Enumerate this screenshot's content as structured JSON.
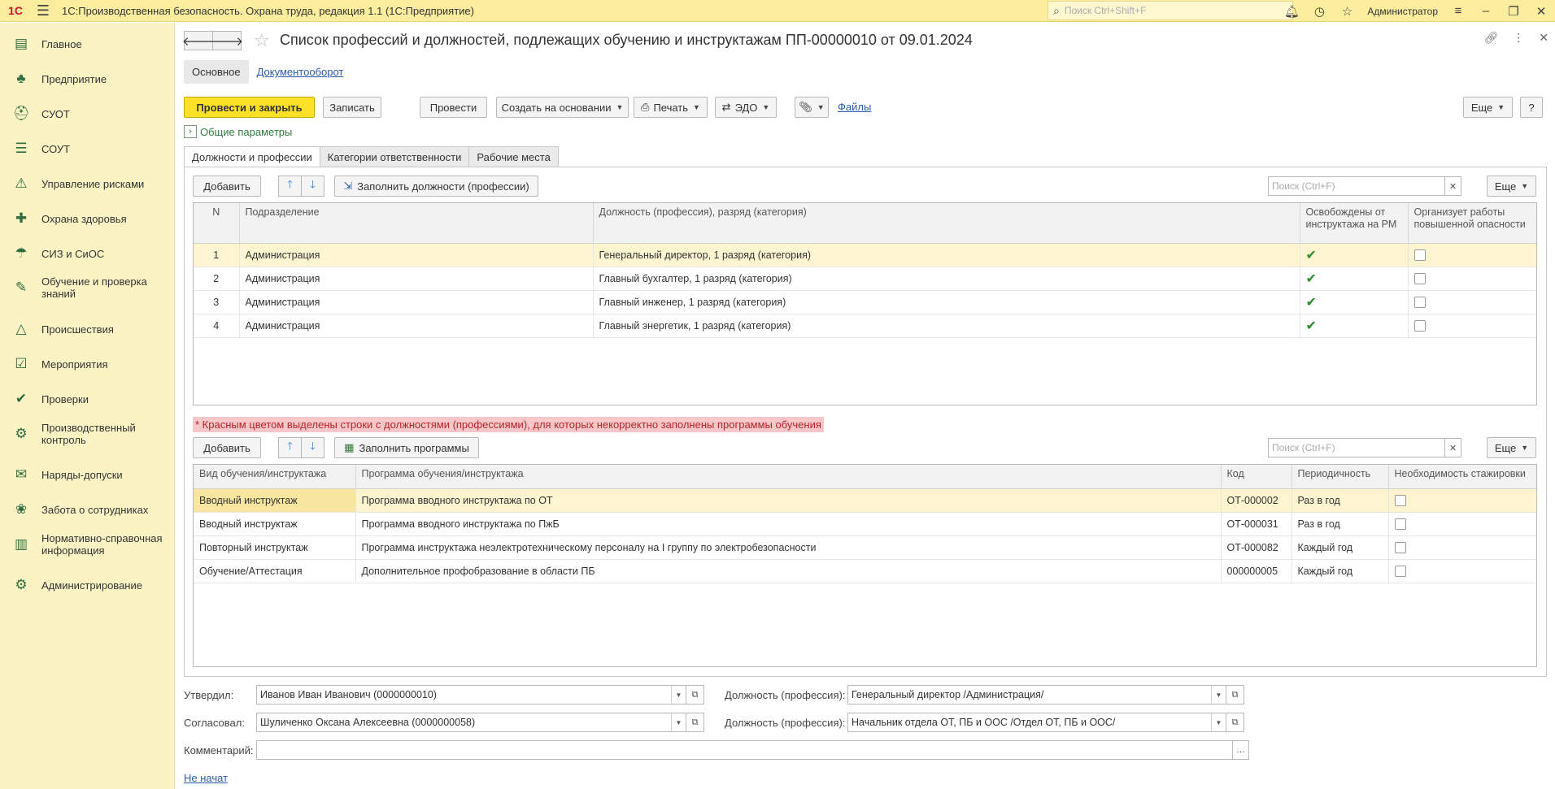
{
  "app": {
    "title": "1С:Производственная безопасность. Охрана труда, редакция 1.1  (1С:Предприятие)",
    "search_placeholder": "Поиск Ctrl+Shift+F",
    "user": "Администратор",
    "logo": "1С"
  },
  "sidebar": {
    "items": [
      {
        "label": "Главное",
        "icon": "dashboard-icon",
        "glyph": "▤"
      },
      {
        "label": "Предприятие",
        "icon": "org-structure-icon",
        "glyph": "♣"
      },
      {
        "label": "СУОТ",
        "icon": "helmet-icon",
        "glyph": "⛑"
      },
      {
        "label": "СОУТ",
        "icon": "checklist-icon",
        "glyph": "☰"
      },
      {
        "label": "Управление рисками",
        "icon": "risk-icon",
        "glyph": "⚠"
      },
      {
        "label": "Охрана здоровья",
        "icon": "health-icon",
        "glyph": "✚"
      },
      {
        "label": "СИЗ и СиОС",
        "icon": "ppe-icon",
        "glyph": "☂"
      },
      {
        "label": "Обучение и проверка знаний",
        "icon": "training-icon",
        "glyph": "✎"
      },
      {
        "label": "Происшествия",
        "icon": "incident-icon",
        "glyph": "△"
      },
      {
        "label": "Мероприятия",
        "icon": "events-icon",
        "glyph": "☑"
      },
      {
        "label": "Проверки",
        "icon": "inspection-icon",
        "glyph": "✔"
      },
      {
        "label": "Производственный контроль",
        "icon": "production-control-icon",
        "glyph": "⚙"
      },
      {
        "label": "Наряды-допуски",
        "icon": "permit-icon",
        "glyph": "✉"
      },
      {
        "label": "Забота о сотрудниках",
        "icon": "care-icon",
        "glyph": "❀"
      },
      {
        "label": "Нормативно-справочная информация",
        "icon": "reference-icon",
        "glyph": "▥"
      },
      {
        "label": "Администрирование",
        "icon": "admin-icon",
        "glyph": "⚙"
      }
    ]
  },
  "document": {
    "title": "Список профессий и должностей, подлежащих обучению и инструктажам ПП-00000010 от 09.01.2024",
    "sec_tab_main": "Основное",
    "sec_tab_docflow": "Документооборот"
  },
  "commands": {
    "post_close": "Провести и закрыть",
    "save": "Записать",
    "post": "Провести",
    "create_based": "Создать на основании",
    "print": "Печать",
    "edo": "ЭДО",
    "files": "Файлы",
    "more": "Еще",
    "help": "?"
  },
  "params_label": "Общие параметры",
  "tabs": [
    "Должности и профессии",
    "Категории ответственности",
    "Рабочие места"
  ],
  "positions": {
    "add": "Добавить",
    "fill": "Заполнить должности (профессии)",
    "search_placeholder": "Поиск (Ctrl+F)",
    "more": "Еще",
    "headers": [
      "N",
      "Подразделение",
      "Должность (профессия), разряд (категория)",
      "Освобождены от инструктажа на РМ",
      "Организует работы повышенной опасности"
    ],
    "rows": [
      {
        "n": "1",
        "dept": "Администрация",
        "position": "Генеральный директор, 1 разряд (категория)",
        "exempt": true,
        "hazard": false
      },
      {
        "n": "2",
        "dept": "Администрация",
        "position": "Главный бухгалтер, 1 разряд (категория)",
        "exempt": true,
        "hazard": false
      },
      {
        "n": "3",
        "dept": "Администрация",
        "position": "Главный инженер, 1 разряд (категория)",
        "exempt": true,
        "hazard": false
      },
      {
        "n": "4",
        "dept": "Администрация",
        "position": "Главный энергетик, 1 разряд (категория)",
        "exempt": true,
        "hazard": false
      }
    ]
  },
  "warning": "* Красным цветом выделены строки с должностями (профессиями), для которых некорректно заполнены программы обучения",
  "programs": {
    "add": "Добавить",
    "fill": "Заполнить программы",
    "search_placeholder": "Поиск (Ctrl+F)",
    "more": "Еще",
    "headers": [
      "Вид обучения/инструктажа",
      "Программа обучения/инструктажа",
      "Код",
      "Периодичность",
      "Необходимость стажировки"
    ],
    "rows": [
      {
        "kind": "Вводный инструктаж",
        "program": "Программа вводного инструктажа по ОТ",
        "code": "ОТ-000002",
        "period": "Раз в год",
        "intern": false
      },
      {
        "kind": "Вводный инструктаж",
        "program": "Программа вводного инструктажа по ПжБ",
        "code": "ОТ-000031",
        "period": "Раз в год",
        "intern": false
      },
      {
        "kind": "Повторный инструктаж",
        "program": "Программа инструктажа неэлектротехническому персоналу на I группу по электробезопасности",
        "code": "ОТ-000082",
        "period": "Каждый год",
        "intern": false
      },
      {
        "kind": "Обучение/Аттестация",
        "program": "Дополнительное профобразование в области ПБ",
        "code": "000000005",
        "period": "Каждый год",
        "intern": false
      }
    ]
  },
  "form": {
    "approved_label": "Утвердил:",
    "approved_value": "Иванов Иван Иванович (0000000010)",
    "agreed_label": "Согласовал:",
    "agreed_value": "Шуличенко Оксана Алексеевна (0000000058)",
    "position_label": "Должность (профессия):",
    "approved_position": "Генеральный директор /Администрация/",
    "agreed_position": "Начальник отдела ОТ, ПБ и ООС /Отдел ОТ, ПБ и ООС/",
    "comment_label": "Комментарий:",
    "comment_value": "",
    "status_link": "Не начат"
  }
}
